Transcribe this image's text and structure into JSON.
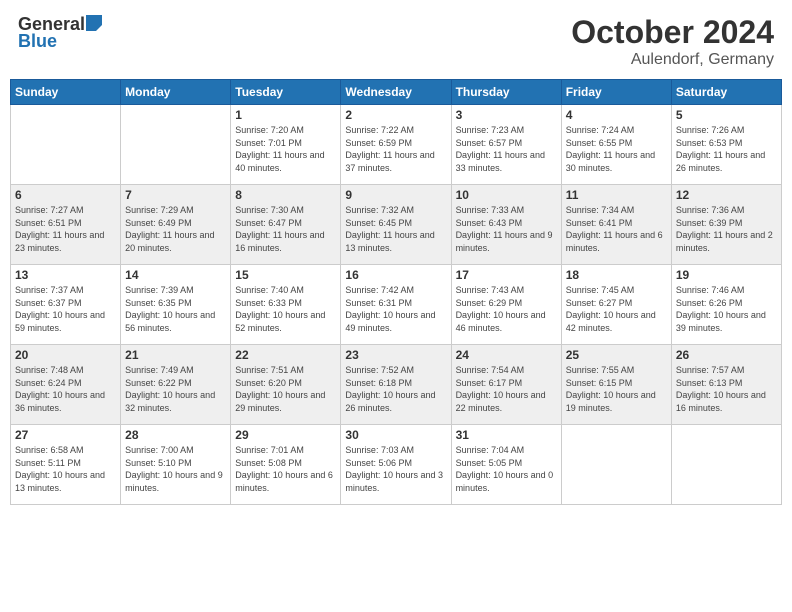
{
  "header": {
    "logo_general": "General",
    "logo_blue": "Blue",
    "month": "October 2024",
    "location": "Aulendorf, Germany"
  },
  "weekdays": [
    "Sunday",
    "Monday",
    "Tuesday",
    "Wednesday",
    "Thursday",
    "Friday",
    "Saturday"
  ],
  "weeks": [
    [
      {
        "day": "",
        "sunrise": "",
        "sunset": "",
        "daylight": ""
      },
      {
        "day": "",
        "sunrise": "",
        "sunset": "",
        "daylight": ""
      },
      {
        "day": "1",
        "sunrise": "Sunrise: 7:20 AM",
        "sunset": "Sunset: 7:01 PM",
        "daylight": "Daylight: 11 hours and 40 minutes."
      },
      {
        "day": "2",
        "sunrise": "Sunrise: 7:22 AM",
        "sunset": "Sunset: 6:59 PM",
        "daylight": "Daylight: 11 hours and 37 minutes."
      },
      {
        "day": "3",
        "sunrise": "Sunrise: 7:23 AM",
        "sunset": "Sunset: 6:57 PM",
        "daylight": "Daylight: 11 hours and 33 minutes."
      },
      {
        "day": "4",
        "sunrise": "Sunrise: 7:24 AM",
        "sunset": "Sunset: 6:55 PM",
        "daylight": "Daylight: 11 hours and 30 minutes."
      },
      {
        "day": "5",
        "sunrise": "Sunrise: 7:26 AM",
        "sunset": "Sunset: 6:53 PM",
        "daylight": "Daylight: 11 hours and 26 minutes."
      }
    ],
    [
      {
        "day": "6",
        "sunrise": "Sunrise: 7:27 AM",
        "sunset": "Sunset: 6:51 PM",
        "daylight": "Daylight: 11 hours and 23 minutes."
      },
      {
        "day": "7",
        "sunrise": "Sunrise: 7:29 AM",
        "sunset": "Sunset: 6:49 PM",
        "daylight": "Daylight: 11 hours and 20 minutes."
      },
      {
        "day": "8",
        "sunrise": "Sunrise: 7:30 AM",
        "sunset": "Sunset: 6:47 PM",
        "daylight": "Daylight: 11 hours and 16 minutes."
      },
      {
        "day": "9",
        "sunrise": "Sunrise: 7:32 AM",
        "sunset": "Sunset: 6:45 PM",
        "daylight": "Daylight: 11 hours and 13 minutes."
      },
      {
        "day": "10",
        "sunrise": "Sunrise: 7:33 AM",
        "sunset": "Sunset: 6:43 PM",
        "daylight": "Daylight: 11 hours and 9 minutes."
      },
      {
        "day": "11",
        "sunrise": "Sunrise: 7:34 AM",
        "sunset": "Sunset: 6:41 PM",
        "daylight": "Daylight: 11 hours and 6 minutes."
      },
      {
        "day": "12",
        "sunrise": "Sunrise: 7:36 AM",
        "sunset": "Sunset: 6:39 PM",
        "daylight": "Daylight: 11 hours and 2 minutes."
      }
    ],
    [
      {
        "day": "13",
        "sunrise": "Sunrise: 7:37 AM",
        "sunset": "Sunset: 6:37 PM",
        "daylight": "Daylight: 10 hours and 59 minutes."
      },
      {
        "day": "14",
        "sunrise": "Sunrise: 7:39 AM",
        "sunset": "Sunset: 6:35 PM",
        "daylight": "Daylight: 10 hours and 56 minutes."
      },
      {
        "day": "15",
        "sunrise": "Sunrise: 7:40 AM",
        "sunset": "Sunset: 6:33 PM",
        "daylight": "Daylight: 10 hours and 52 minutes."
      },
      {
        "day": "16",
        "sunrise": "Sunrise: 7:42 AM",
        "sunset": "Sunset: 6:31 PM",
        "daylight": "Daylight: 10 hours and 49 minutes."
      },
      {
        "day": "17",
        "sunrise": "Sunrise: 7:43 AM",
        "sunset": "Sunset: 6:29 PM",
        "daylight": "Daylight: 10 hours and 46 minutes."
      },
      {
        "day": "18",
        "sunrise": "Sunrise: 7:45 AM",
        "sunset": "Sunset: 6:27 PM",
        "daylight": "Daylight: 10 hours and 42 minutes."
      },
      {
        "day": "19",
        "sunrise": "Sunrise: 7:46 AM",
        "sunset": "Sunset: 6:26 PM",
        "daylight": "Daylight: 10 hours and 39 minutes."
      }
    ],
    [
      {
        "day": "20",
        "sunrise": "Sunrise: 7:48 AM",
        "sunset": "Sunset: 6:24 PM",
        "daylight": "Daylight: 10 hours and 36 minutes."
      },
      {
        "day": "21",
        "sunrise": "Sunrise: 7:49 AM",
        "sunset": "Sunset: 6:22 PM",
        "daylight": "Daylight: 10 hours and 32 minutes."
      },
      {
        "day": "22",
        "sunrise": "Sunrise: 7:51 AM",
        "sunset": "Sunset: 6:20 PM",
        "daylight": "Daylight: 10 hours and 29 minutes."
      },
      {
        "day": "23",
        "sunrise": "Sunrise: 7:52 AM",
        "sunset": "Sunset: 6:18 PM",
        "daylight": "Daylight: 10 hours and 26 minutes."
      },
      {
        "day": "24",
        "sunrise": "Sunrise: 7:54 AM",
        "sunset": "Sunset: 6:17 PM",
        "daylight": "Daylight: 10 hours and 22 minutes."
      },
      {
        "day": "25",
        "sunrise": "Sunrise: 7:55 AM",
        "sunset": "Sunset: 6:15 PM",
        "daylight": "Daylight: 10 hours and 19 minutes."
      },
      {
        "day": "26",
        "sunrise": "Sunrise: 7:57 AM",
        "sunset": "Sunset: 6:13 PM",
        "daylight": "Daylight: 10 hours and 16 minutes."
      }
    ],
    [
      {
        "day": "27",
        "sunrise": "Sunrise: 6:58 AM",
        "sunset": "Sunset: 5:11 PM",
        "daylight": "Daylight: 10 hours and 13 minutes."
      },
      {
        "day": "28",
        "sunrise": "Sunrise: 7:00 AM",
        "sunset": "Sunset: 5:10 PM",
        "daylight": "Daylight: 10 hours and 9 minutes."
      },
      {
        "day": "29",
        "sunrise": "Sunrise: 7:01 AM",
        "sunset": "Sunset: 5:08 PM",
        "daylight": "Daylight: 10 hours and 6 minutes."
      },
      {
        "day": "30",
        "sunrise": "Sunrise: 7:03 AM",
        "sunset": "Sunset: 5:06 PM",
        "daylight": "Daylight: 10 hours and 3 minutes."
      },
      {
        "day": "31",
        "sunrise": "Sunrise: 7:04 AM",
        "sunset": "Sunset: 5:05 PM",
        "daylight": "Daylight: 10 hours and 0 minutes."
      },
      {
        "day": "",
        "sunrise": "",
        "sunset": "",
        "daylight": ""
      },
      {
        "day": "",
        "sunrise": "",
        "sunset": "",
        "daylight": ""
      }
    ]
  ]
}
